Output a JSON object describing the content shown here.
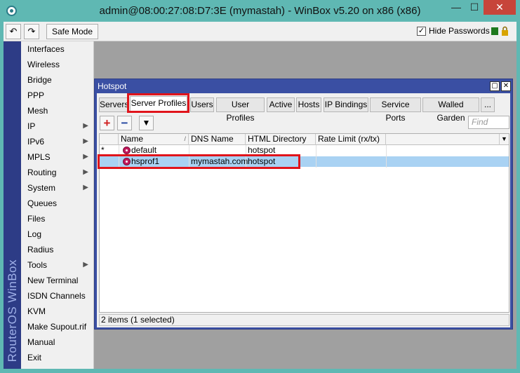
{
  "window": {
    "title": "admin@08:00:27:08:D7:3E (mymastah) - WinBox v5.20 on x86 (x86)",
    "minimize": "—",
    "maximize": "☐",
    "close": "✕"
  },
  "toolbar": {
    "undo": "↶",
    "redo": "↷",
    "safe_mode": "Safe Mode",
    "hide_passwords_label": "Hide Passwords",
    "hide_passwords_checked": "✓"
  },
  "brand": "RouterOS WinBox",
  "menu": [
    {
      "label": "Interfaces",
      "arrow": ""
    },
    {
      "label": "Wireless",
      "arrow": ""
    },
    {
      "label": "Bridge",
      "arrow": ""
    },
    {
      "label": "PPP",
      "arrow": ""
    },
    {
      "label": "Mesh",
      "arrow": ""
    },
    {
      "label": "IP",
      "arrow": "▶"
    },
    {
      "label": "IPv6",
      "arrow": "▶"
    },
    {
      "label": "MPLS",
      "arrow": "▶"
    },
    {
      "label": "Routing",
      "arrow": "▶"
    },
    {
      "label": "System",
      "arrow": "▶"
    },
    {
      "label": "Queues",
      "arrow": ""
    },
    {
      "label": "Files",
      "arrow": ""
    },
    {
      "label": "Log",
      "arrow": ""
    },
    {
      "label": "Radius",
      "arrow": ""
    },
    {
      "label": "Tools",
      "arrow": "▶"
    },
    {
      "label": "New Terminal",
      "arrow": ""
    },
    {
      "label": "ISDN Channels",
      "arrow": ""
    },
    {
      "label": "KVM",
      "arrow": ""
    },
    {
      "label": "Make Supout.rif",
      "arrow": ""
    },
    {
      "label": "Manual",
      "arrow": ""
    },
    {
      "label": "Exit",
      "arrow": ""
    }
  ],
  "hotspot": {
    "title": "Hotspot",
    "restore": "▢",
    "close": "✕",
    "tabs": [
      "Servers",
      "Server Profiles",
      "Users",
      "User Profiles",
      "Active",
      "Hosts",
      "IP Bindings",
      "Service Ports",
      "Walled Garden",
      "..."
    ],
    "active_tab": "Server Profiles",
    "add": "+",
    "remove": "−",
    "filter": "▼",
    "find_placeholder": "Find",
    "columns": [
      "Name",
      "DNS Name",
      "HTML Directory",
      "Rate Limit (rx/tx)"
    ],
    "sort_mark": "/",
    "menu_arrow": "▼",
    "rows": [
      {
        "flag": "*",
        "name": "default",
        "dns": "",
        "html_dir": "hotspot",
        "rate": ""
      },
      {
        "flag": "",
        "name": "hsprof1",
        "dns": "mymastah.com",
        "html_dir": "hotspot",
        "rate": ""
      }
    ],
    "status": "2 items (1 selected)"
  },
  "colors": {
    "accent": "#3a4fa3",
    "brand_bar": "#2d3c86",
    "highlight_box": "#e0141b",
    "selected_row": "#a9d2f3"
  }
}
